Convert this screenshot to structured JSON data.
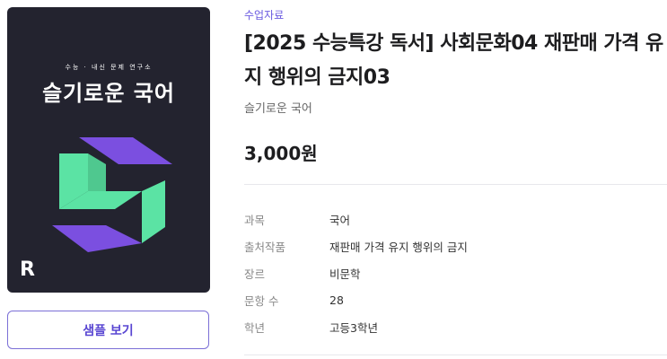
{
  "cover": {
    "subtitle": "수능 · 내신 문제 연구소",
    "title": "슬기로운 국어",
    "colors": {
      "background": "#23232f",
      "green": "#5be3a4",
      "purple": "#7b4fe0"
    }
  },
  "sample_button": {
    "label": "샘플 보기"
  },
  "product": {
    "category": "수업자료",
    "title": "[2025 수능특강 독서] 사회문화04 재판매 가격 유지 행위의 금지03",
    "author": "슬기로운 국어",
    "price": "3,000원"
  },
  "specs": [
    {
      "key": "과목",
      "value": "국어"
    },
    {
      "key": "출처작품",
      "value": "재판매 가격 유지 행위의 금지"
    },
    {
      "key": "장르",
      "value": "비문학"
    },
    {
      "key": "문항 수",
      "value": "28"
    },
    {
      "key": "학년",
      "value": "고등3학년"
    }
  ],
  "colors": {
    "accent": "#6a5ae0",
    "button_border": "#7b6fd6"
  }
}
